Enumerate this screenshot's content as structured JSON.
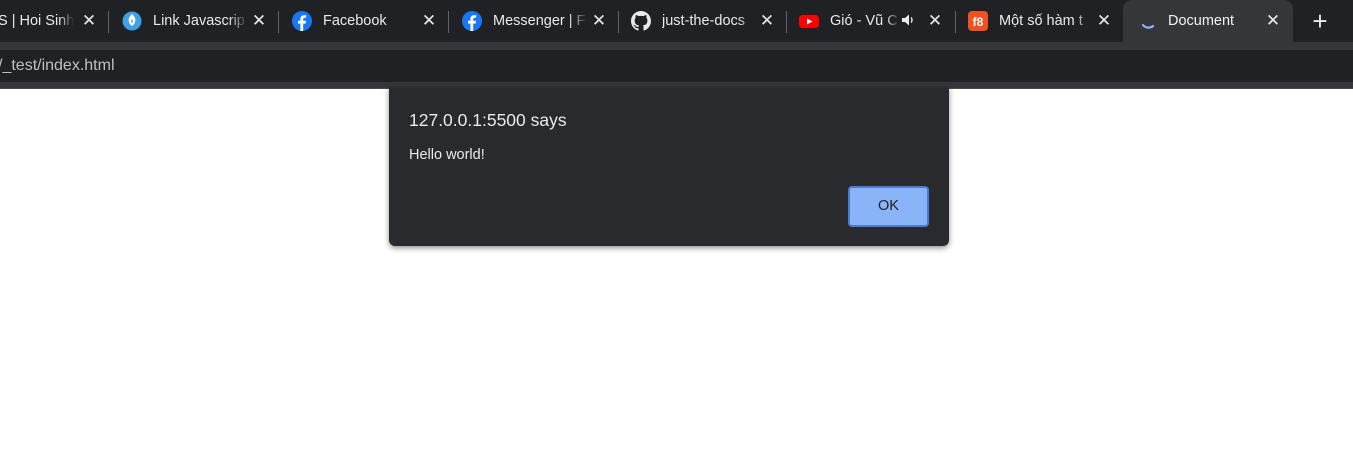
{
  "tabs": [
    {
      "label": "S | Hoi Sinh",
      "icon": "partial-favicon",
      "close": "✕"
    },
    {
      "label": "Link Javascrip",
      "icon": "blue-fire-icon",
      "close": "✕"
    },
    {
      "label": "Facebook",
      "icon": "facebook-icon",
      "close": "✕"
    },
    {
      "label": "Messenger | F",
      "icon": "facebook-icon",
      "close": "✕"
    },
    {
      "label": "just-the-docs",
      "icon": "github-icon",
      "close": "✕"
    },
    {
      "label": "Gió - Vũ C",
      "icon": "youtube-icon",
      "close": "✕",
      "audio": "🔈"
    },
    {
      "label": "Một số hàm t",
      "icon": "f8-icon",
      "close": "✕"
    },
    {
      "label": "Document",
      "icon": "loading-spinner-icon",
      "close": "✕",
      "active": true
    }
  ],
  "newtab": "+",
  "address_bar": {
    "url": "/_test/index.html"
  },
  "dialog": {
    "title": "127.0.0.1:5500 says",
    "message": "Hello world!",
    "ok_label": "OK"
  },
  "colors": {
    "tabstrip": "#202124",
    "active_tab": "#35363a",
    "dialog_bg": "#292a2d",
    "ok_button": "#8ab4f8",
    "facebook": "#1877f2",
    "youtube": "#ff0000",
    "f8": "#f05123"
  }
}
